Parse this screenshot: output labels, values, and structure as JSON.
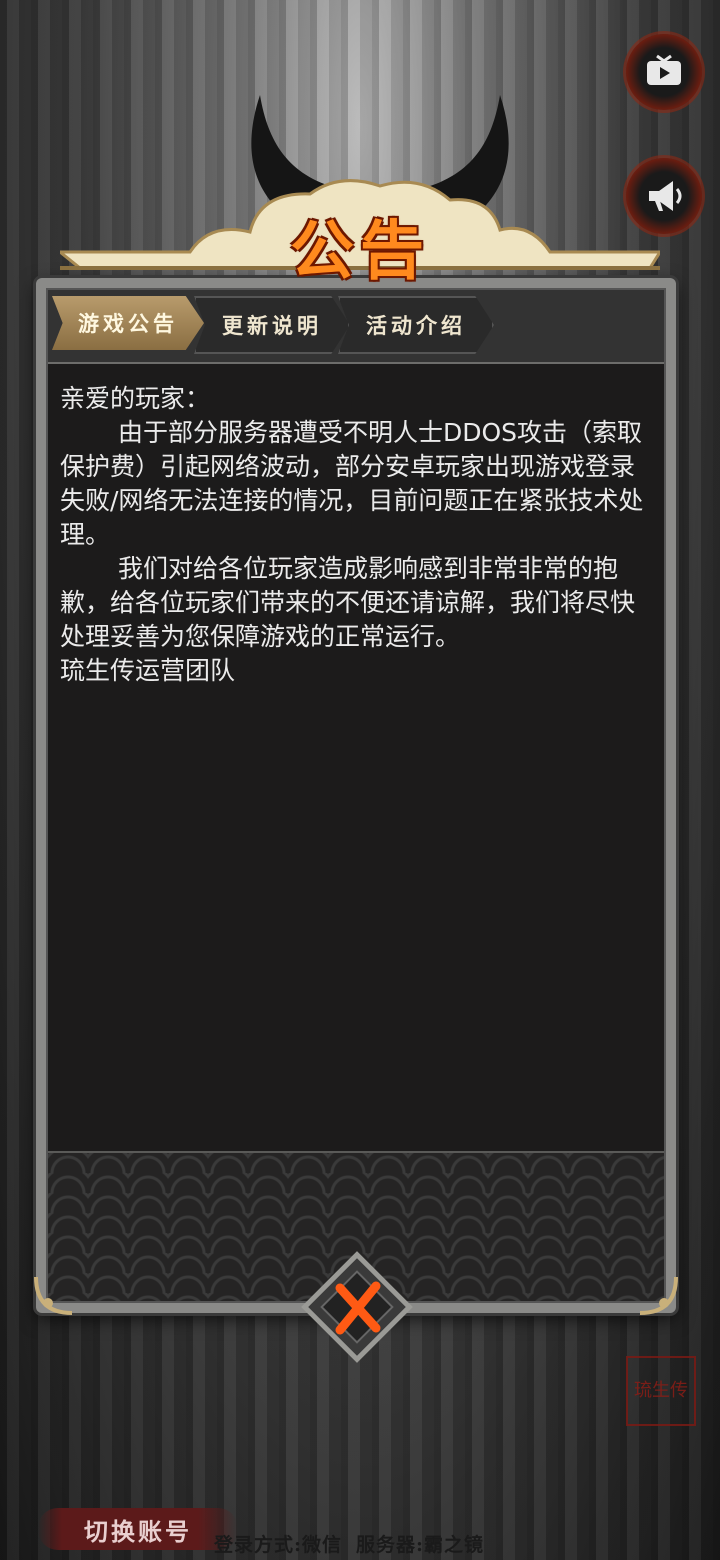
{
  "title": "公告",
  "tabs": [
    {
      "label": "游戏公告",
      "active": true
    },
    {
      "label": "更新说明",
      "active": false
    },
    {
      "label": "活动介绍",
      "active": false
    }
  ],
  "announcement": {
    "greeting": "亲爱的玩家：",
    "paragraph1": "由于部分服务器遭受不明人士DDOS攻击（索取保护费）引起网络波动，部分安卓玩家出现游戏登录失败/网络无法连接的情况，目前问题正在紧张技术处理。",
    "paragraph2": "我们对给各位玩家造成影响感到非常非常的抱歉，给各位玩家们带来的不便还请谅解，我们将尽快处理妥善为您保障游戏的正常运行。",
    "signature": "琉生传运营团队"
  },
  "footer": {
    "switch_account": "切换账号",
    "login_method": "登录方式:微信",
    "server": "服务器:霸之镜"
  },
  "seal_text": "琉生传",
  "icons": {
    "video": "video-icon",
    "horn": "megaphone-icon",
    "close": "close-x-icon"
  },
  "colors": {
    "title": "#ff8a1e",
    "close_x": "#ff5a14",
    "active_tab": "#b89b6c",
    "seal": "#8a1d16"
  }
}
